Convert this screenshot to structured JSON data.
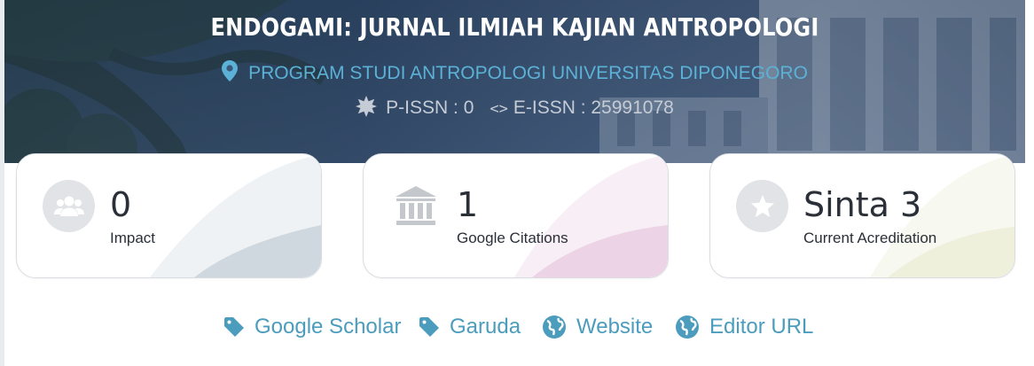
{
  "hero": {
    "title": "ENDOGAMI: JURNAL ILMIAH KAJIAN ANTROPOLOGI",
    "publisher": "PROGRAM STUDI ANTROPOLOGI UNIVERSITAS DIPONEGORO",
    "p_issn": "P-ISSN : 0",
    "e_issn": "E-ISSN : 25991078",
    "icons": {
      "publisher": "map-pin-icon",
      "p_issn": "certificate-icon",
      "e_issn": "code-icon"
    }
  },
  "stats": [
    {
      "value": "0",
      "label": "Impact",
      "icon": "users-icon",
      "wave_color": "#cfd8de"
    },
    {
      "value": "1",
      "label": "Google Citations",
      "icon": "institution-icon",
      "wave_color": "#ecd3e6"
    },
    {
      "value": "Sinta 3",
      "label": "Current Acreditation",
      "icon": "star-icon",
      "wave_color": "#eef0dc"
    }
  ],
  "links": [
    {
      "label": "Google Scholar",
      "icon": "tag-icon"
    },
    {
      "label": "Garuda",
      "icon": "tag-icon"
    },
    {
      "label": "Website",
      "icon": "globe-icon"
    },
    {
      "label": "Editor URL",
      "icon": "globe-icon"
    }
  ],
  "colors": {
    "accent": "#4b9cbd",
    "publisher_text": "#5bb1d6",
    "title_text": "#ffffff",
    "badge_bg": "#e1e3e6",
    "icon_gray": "#c4c7cb"
  }
}
